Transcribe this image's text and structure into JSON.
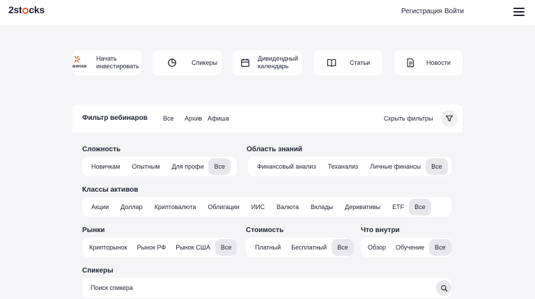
{
  "header": {
    "logo_text_a": "2st",
    "logo_text_b": "cks",
    "register": "Регистрация",
    "login": "Войти"
  },
  "quick_cards": [
    {
      "label_line1": "Начать",
      "label_line2": "инвестировать",
      "icon": "finam-logo",
      "logo_text": "ФИНАМ"
    },
    {
      "label_line1": "Спикеры",
      "label_line2": "",
      "icon": "pie-chart-icon"
    },
    {
      "label_line1": "Дивидендный",
      "label_line2": "календарь",
      "icon": "calendar-icon"
    },
    {
      "label_line1": "Статьи",
      "label_line2": "",
      "icon": "book-icon"
    },
    {
      "label_line1": "Новости",
      "label_line2": "",
      "icon": "document-icon"
    }
  ],
  "filter_bar": {
    "title": "Фильтр вебинаров",
    "tabs": [
      "Все",
      "Архив",
      "Афиша"
    ],
    "hide_filters": "Скрыть фильтры"
  },
  "groups": {
    "difficulty": {
      "label": "Сложность",
      "options": [
        "Новичкам",
        "Опытным",
        "Для профи",
        "Все"
      ]
    },
    "knowledge": {
      "label": "Область знаний",
      "options": [
        "Финансовый анализ",
        "Теханализ",
        "Личные финансы",
        "Все"
      ]
    },
    "assets": {
      "label": "Классы активов",
      "options": [
        "Акции",
        "Доллар",
        "Криптовалюта",
        "Облигации",
        "ИИС",
        "Валюта",
        "Вклады",
        "Деривативы",
        "ETF",
        "Все"
      ]
    },
    "markets": {
      "label": "Рынки",
      "options": [
        "Крипторынок",
        "Рынок РФ",
        "Рынок США",
        "Все"
      ]
    },
    "cost": {
      "label": "Стоимость",
      "options": [
        "Платный",
        "Бесплатный",
        "Все"
      ]
    },
    "inside": {
      "label": "Что внутри",
      "options": [
        "Обзор",
        "Обучение",
        "Все"
      ]
    },
    "speakers": {
      "label": "Спикеры",
      "search_placeholder": "Поиск спикера"
    }
  }
}
